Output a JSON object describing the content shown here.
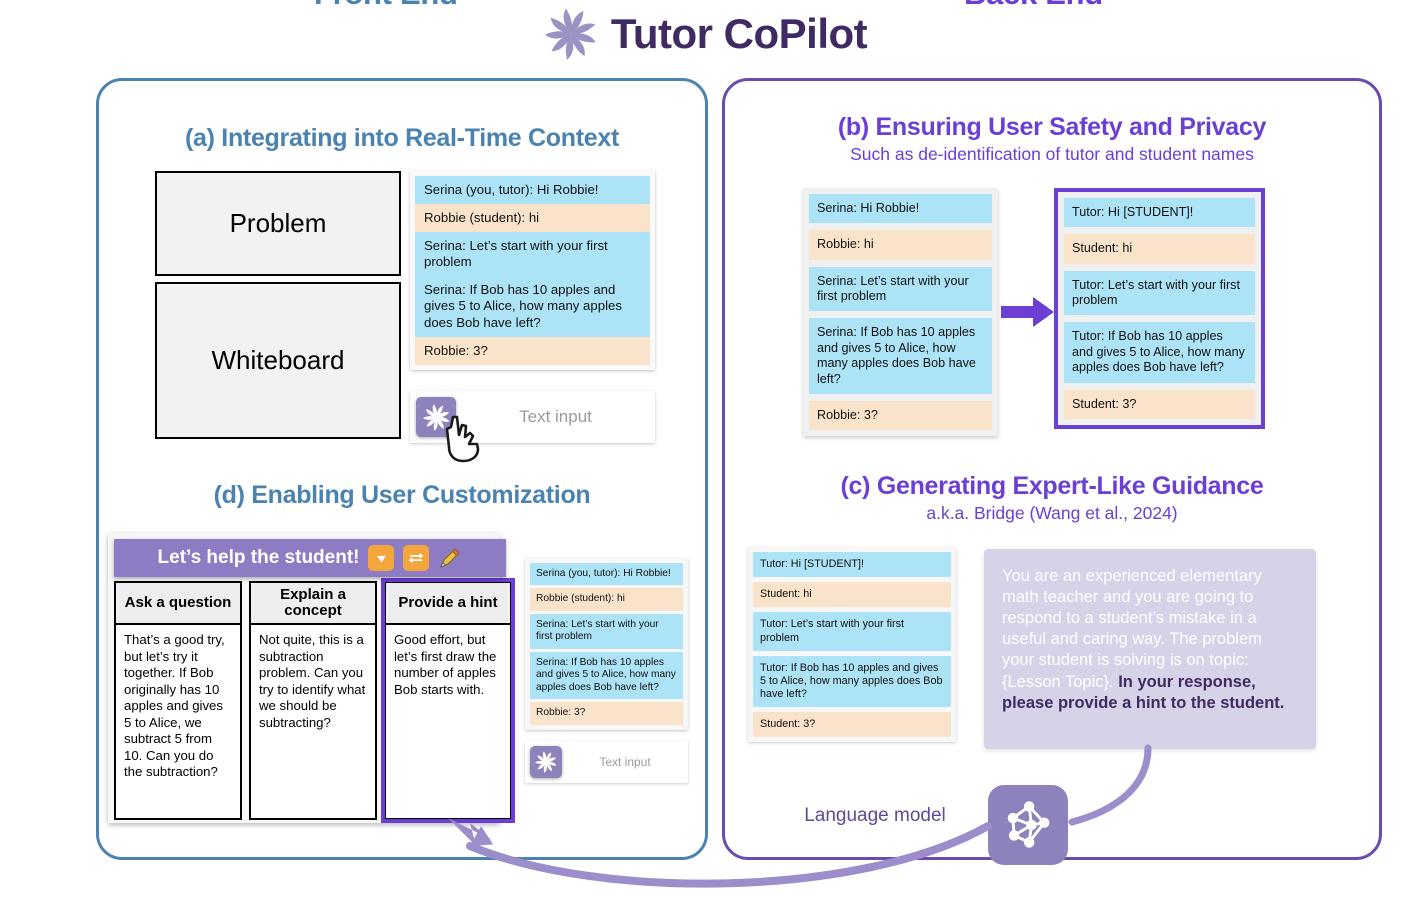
{
  "app": {
    "title": "Tutor CoPilot",
    "logo_icon": "pinwheel-logo-icon"
  },
  "panels": {
    "frontend_label": "Front End",
    "backend_label": "Back End",
    "frontend_color": "#4a82b0",
    "backend_color": "#6b3fd4"
  },
  "section_a": {
    "title": "(a) Integrating into Real-Time Context",
    "problem_label": "Problem",
    "whiteboard_label": "Whiteboard",
    "chat": [
      {
        "role": "tutor",
        "text": "Serina (you, tutor): Hi Robbie!"
      },
      {
        "role": "student",
        "text": "Robbie (student): hi"
      },
      {
        "role": "tutor",
        "text": "Serina: Let’s start with your first problem"
      },
      {
        "role": "tutor",
        "text": "Serina: If Bob has 10 apples and gives 5 to Alice, how many apples does Bob have left?"
      },
      {
        "role": "student",
        "text": "Robbie: 3?"
      }
    ],
    "input_placeholder": "Text input",
    "send_icon": "pinwheel-send-icon",
    "cursor_icon": "hand-cursor-icon"
  },
  "section_b": {
    "title": "(b) Ensuring User Safety and Privacy",
    "subtitle": "Such as de-identification of tutor and student names",
    "before": [
      {
        "role": "tutor",
        "text": "Serina: Hi Robbie!"
      },
      {
        "role": "student",
        "text": "Robbie: hi"
      },
      {
        "role": "tutor",
        "text": "Serina: Let’s start with your first problem"
      },
      {
        "role": "tutor",
        "text": "Serina: If Bob has 10 apples and gives 5 to Alice, how many apples does Bob have left?"
      },
      {
        "role": "student",
        "text": "Robbie: 3?"
      }
    ],
    "after": [
      {
        "role": "tutor",
        "text": "Tutor: Hi [STUDENT]!"
      },
      {
        "role": "student",
        "text": "Student: hi"
      },
      {
        "role": "tutor",
        "text": "Tutor: Let’s start with your first problem"
      },
      {
        "role": "tutor",
        "text": "Tutor: If Bob has 10 apples and gives 5 to Alice, how many apples does Bob have left?"
      },
      {
        "role": "student",
        "text": "Student: 3?"
      }
    ],
    "arrow_icon": "right-arrow-icon"
  },
  "section_c": {
    "title": "(c) Generating Expert-Like Guidance",
    "subtitle": "a.k.a. Bridge (Wang et al., 2024)",
    "chat": [
      {
        "role": "tutor",
        "text": "Tutor: Hi [STUDENT]!"
      },
      {
        "role": "student",
        "text": "Student: hi"
      },
      {
        "role": "tutor",
        "text": "Tutor: Let’s start with your first problem"
      },
      {
        "role": "tutor",
        "text": "Tutor: If Bob has 10 apples and gives 5 to Alice, how many apples does Bob have left?"
      },
      {
        "role": "student",
        "text": "Student: 3?"
      }
    ],
    "prompt_template": "You are an experienced elementary math teacher and you are going to respond to a student’s mistake in a useful and caring way. The problem your student is solving is on topic: {Lesson Topic}. ",
    "prompt_instruction": "In your response, please provide a hint to the student.",
    "llm_label": "Language model",
    "llm_icon": "neural-network-icon"
  },
  "section_d": {
    "title": "(d) Enabling User Customization",
    "header_text": "Let’s help the student!",
    "header_icons": [
      "chevron-down-icon",
      "regenerate-swap-icon",
      "pencil-edit-icon"
    ],
    "options": [
      {
        "label": "Ask a question",
        "text": "That’s a good try, but let’s try it together. If Bob originally has 10 apples and gives 5 to Alice, we subtract 5 from 10. Can you do the subtraction?",
        "selected": false
      },
      {
        "label": "Explain a concept",
        "text": "Not quite, this is a subtraction problem. Can you try to identify what we should be subtracting?",
        "selected": false
      },
      {
        "label": "Provide a hint",
        "text": "Good effort, but let’s first draw the number of apples Bob starts with.",
        "selected": true
      }
    ],
    "chat": [
      {
        "role": "tutor",
        "text": "Serina (you, tutor): Hi Robbie!"
      },
      {
        "role": "student",
        "text": "Robbie (student): hi"
      },
      {
        "role": "tutor",
        "text": "Serina: Let’s start with your first problem"
      },
      {
        "role": "tutor",
        "text": "Serina: If Bob has 10 apples and gives 5 to Alice, how many apples does Bob have left?"
      },
      {
        "role": "student",
        "text": "Robbie: 3?"
      }
    ],
    "input_placeholder": "Text input",
    "send_icon": "pinwheel-send-icon"
  },
  "colors": {
    "tutor_bubble": "#ace3f7",
    "student_bubble": "#fae3cb",
    "accent_purple": "#6b3fd4",
    "accent_blue": "#4a82b0",
    "orange_icon": "#f2a63c",
    "llm_purple": "#8d82bb"
  }
}
